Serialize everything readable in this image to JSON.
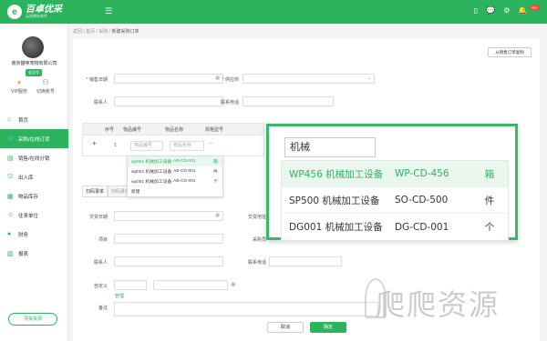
{
  "brand": {
    "name": "百卓优采",
    "slogan": "云进销存软件",
    "color": "#2bb35e"
  },
  "topbar": {
    "menu_icon": "menu-icon",
    "icons": [
      "mobile-icon",
      "message-icon",
      "gear-icon",
      "bell-icon"
    ],
    "badge": "99+"
  },
  "sidebar": {
    "company": "南京猫咪宠物有限公司",
    "member_tag": "会员号",
    "vip_label": "VIP服务",
    "switch_label": "切换账号",
    "items": [
      {
        "label": "首页",
        "icon": "home-icon"
      },
      {
        "label": "采购/在线订货",
        "icon": "cart-icon",
        "active": true
      },
      {
        "label": "销售/在线分销",
        "icon": "sales-icon"
      },
      {
        "label": "出入库",
        "icon": "warehouse-icon"
      },
      {
        "label": "物品库存",
        "icon": "inventory-icon"
      },
      {
        "label": "往来单位",
        "icon": "contacts-icon"
      },
      {
        "label": "财务",
        "icon": "finance-icon"
      },
      {
        "label": "报表",
        "icon": "report-icon"
      }
    ],
    "find_supplier": "寻找货源"
  },
  "breadcrumb": {
    "items": [
      "返回",
      "首页",
      "采购"
    ],
    "current": "新建采购订单"
  },
  "form": {
    "copy_button": "从销售订单复制",
    "sale_date_label": "销售日期",
    "supplier_label": "供应商",
    "contact_label": "联系人",
    "phone_label": "联系电话",
    "delivery_date_label": "交货日期",
    "delivery_addr_label": "交货地址",
    "project_label": "项目",
    "buyer_label": "采购员",
    "contact2_label": "联系人",
    "phone2_label": "联系电话",
    "custom_label": "自定义",
    "manage_link": "管理",
    "remark_label": "备注"
  },
  "table": {
    "headers": [
      "序号",
      "物品编号",
      "物品名称",
      "规格型号"
    ],
    "row_index": "1",
    "code_placeholder": "物品编号",
    "name_placeholder": "物品名称",
    "ellipsis": "···"
  },
  "small_dropdown": {
    "rows": [
      {
        "a": "wp001 机械加工设备",
        "b": "AB-CD-001",
        "c": "箱"
      },
      {
        "a": "wp001 机械加工设备",
        "b": "AB-CD-001",
        "c": "件"
      },
      {
        "a": "wp001 机械加工设备",
        "b": "AB-CD-001",
        "c": "个"
      }
    ],
    "new_label": "新建"
  },
  "bottom_tabs": [
    "扫码录单",
    "扫码录单"
  ],
  "buttons": {
    "cancel": "取消",
    "confirm": "确定"
  },
  "popup": {
    "search_value": "机械",
    "rows": [
      {
        "name": "WP456 机械加工设备",
        "spec": "WP-CD-456",
        "unit": "箱",
        "selected": true
      },
      {
        "name": "SP500 机械加工设备",
        "spec": "SO-CD-500",
        "unit": "件"
      },
      {
        "name": "DG001 机械加工设备",
        "spec": "DG-CD-001",
        "unit": "个"
      }
    ]
  },
  "watermark": "爬爬资源"
}
